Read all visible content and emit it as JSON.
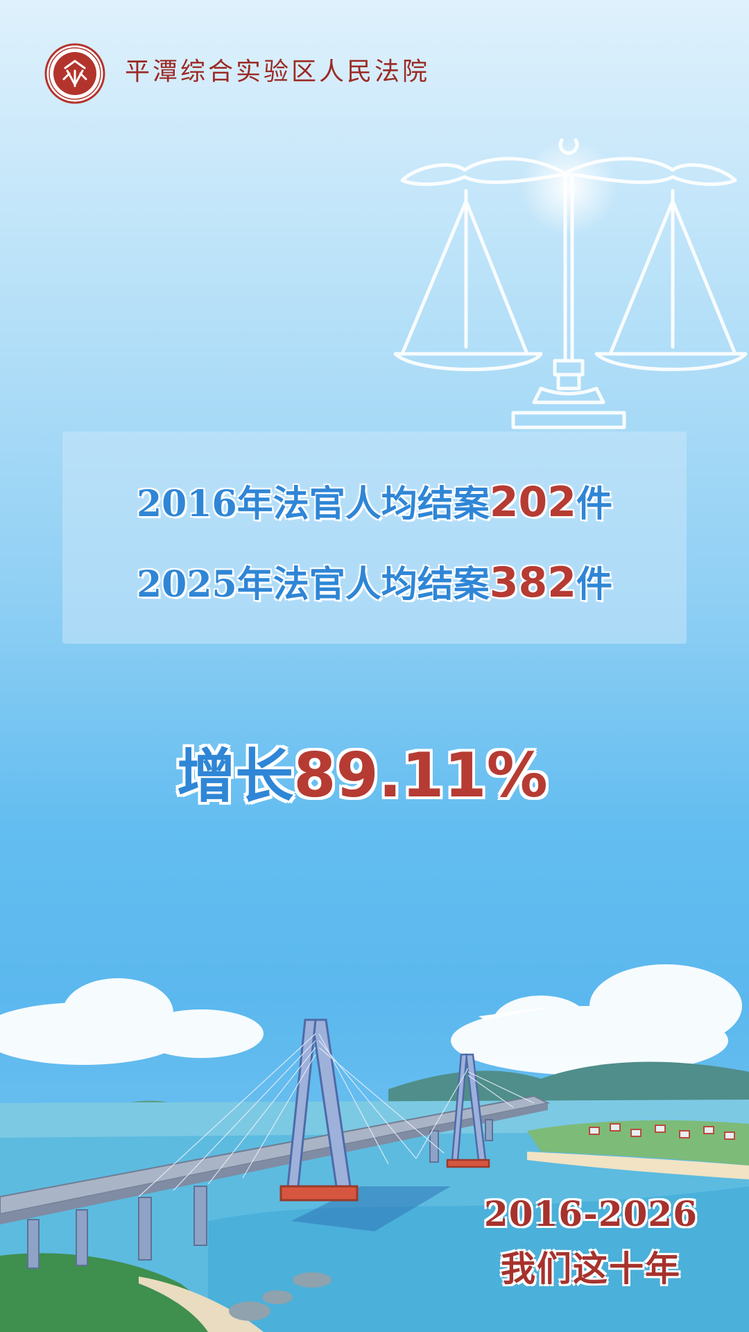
{
  "header": {
    "org_name": "平潭综合实验区人民法院",
    "logo_icon": "court-seal-icon"
  },
  "stats": {
    "line1": {
      "prefix": "2016年法官人均结案",
      "value": "202",
      "suffix": "件"
    },
    "line2": {
      "prefix": "2025年法官人均结案",
      "value": "382",
      "suffix": "件"
    }
  },
  "growth": {
    "label": "增长",
    "value": "89.11%"
  },
  "footer": {
    "range": "2016-2026",
    "slogan": "我们这十年"
  },
  "colors": {
    "accent_red": "#b63b33",
    "accent_blue": "#2f86d6",
    "seal_red": "#9b2a25"
  },
  "icons": {
    "scales": "scales-of-justice-icon",
    "scene": "sea-bridge-illustration"
  }
}
